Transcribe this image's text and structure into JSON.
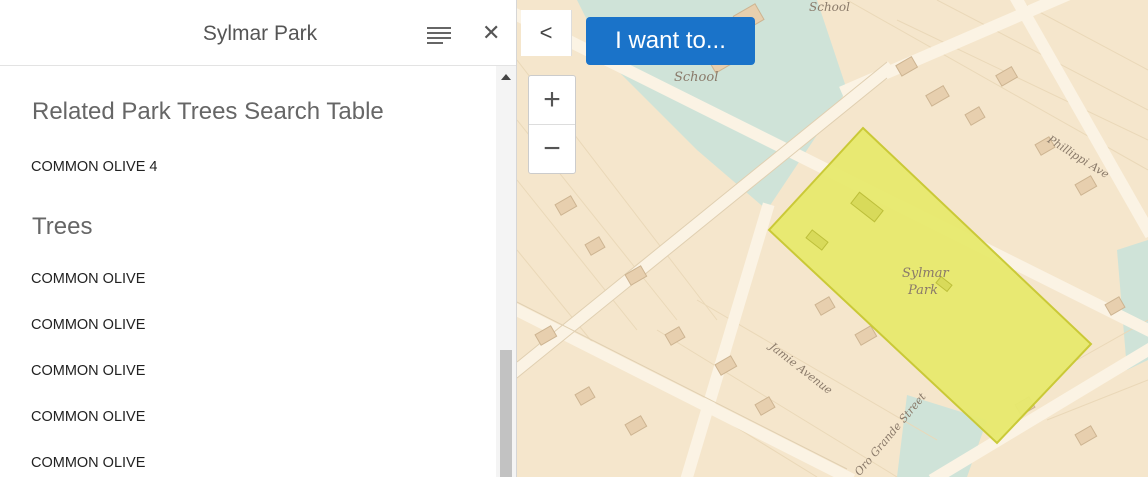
{
  "panel": {
    "title": "Sylmar Park",
    "sections": [
      {
        "heading": "Related Park Trees Search Table",
        "items": [
          "COMMON OLIVE 4"
        ]
      },
      {
        "heading": "Trees",
        "items": [
          "COMMON OLIVE",
          "COMMON OLIVE",
          "COMMON OLIVE",
          "COMMON OLIVE",
          "COMMON OLIVE"
        ]
      }
    ],
    "close_glyph": "✕"
  },
  "toolbar": {
    "collapse_glyph": "<",
    "iwant_label": "I want to...",
    "zoom_in": "+",
    "zoom_out": "−"
  },
  "map": {
    "labels": {
      "school_top": "School",
      "school": "School",
      "park_line1": "Sylmar",
      "park_line2": "Park",
      "street_phillippi": "Phillippi Ave",
      "street_jamie": "Jamie Avenue",
      "street_grande": "Oro Grande Street"
    },
    "colors": {
      "park_fill": "#e8ea6e",
      "park_stroke": "#c8c830",
      "school_fill": "#cfe3d8",
      "road": "#fbf3e4",
      "accent": "#1a73c9"
    }
  }
}
